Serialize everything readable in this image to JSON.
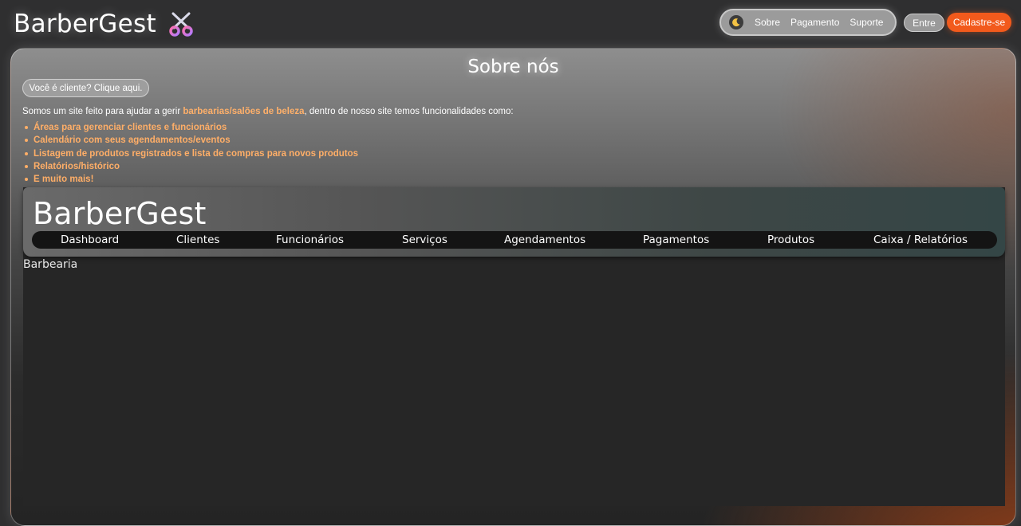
{
  "header": {
    "brand": "BarberGest",
    "nav": {
      "links": [
        "Sobre",
        "Pagamento",
        "Suporte"
      ]
    },
    "login_label": "Entre",
    "signup_label": "Cadastre-se",
    "signup_color": "#f25a1c"
  },
  "about": {
    "title": "Sobre nós",
    "client_button": "Você é cliente? Clique aqui.",
    "intro_before": "Somos um site feito para ajudar a gerir ",
    "intro_highlight": "barbearias/salões de beleza",
    "intro_after": ", dentro de nosso site temos funcionalidades como:",
    "features": [
      "Áreas para gerenciar clientes e funcionários",
      "Calendário com seus agendamentos/eventos",
      "Listagem de produtos registrados e lista de compras para novos produtos",
      "Relatórios/histórico",
      "E muito mais!"
    ],
    "highlight_color": "#ffae67"
  },
  "preview": {
    "brand": "BarberGest",
    "nav": [
      "Dashboard",
      "Clientes",
      "Funcionários",
      "Serviços",
      "Agendamentos",
      "Pagamentos",
      "Produtos",
      "Caixa / Relatórios"
    ],
    "subtitle": "Barbearia"
  }
}
